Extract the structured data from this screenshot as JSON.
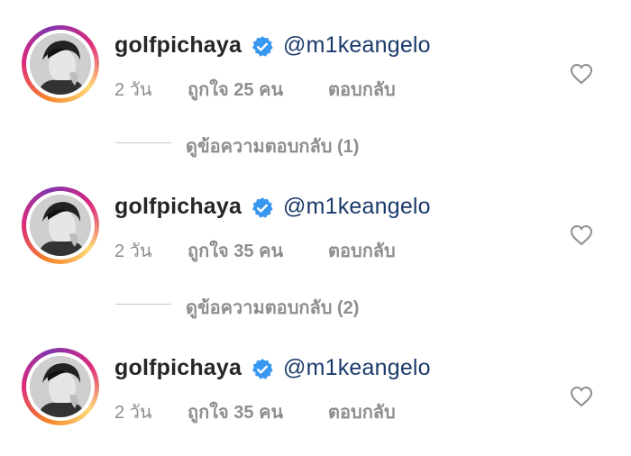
{
  "comments": [
    {
      "username": "golfpichaya",
      "mention": "@m1keangelo",
      "time": "2 วัน",
      "likes": "ถูกใจ 25 คน",
      "reply": "ตอบกลับ"
    },
    {
      "username": "golfpichaya",
      "mention": "@m1keangelo",
      "time": "2 วัน",
      "likes": "ถูกใจ 35 คน",
      "reply": "ตอบกลับ"
    },
    {
      "username": "golfpichaya",
      "mention": "@m1keangelo",
      "time": "2 วัน",
      "likes": "ถูกใจ 35 คน",
      "reply": "ตอบกลับ"
    }
  ],
  "view_replies": [
    {
      "label": "ดูข้อความตอบกลับ (1)"
    },
    {
      "label": "ดูข้อความตอบกลับ (2)"
    }
  ],
  "colors": {
    "verified": "#3897f0",
    "text": "#262626",
    "secondary": "#8e8e8e",
    "mention": "#1b3a6b"
  },
  "icons": {
    "verified": "verified-badge-icon",
    "like": "heart-outline-icon"
  }
}
